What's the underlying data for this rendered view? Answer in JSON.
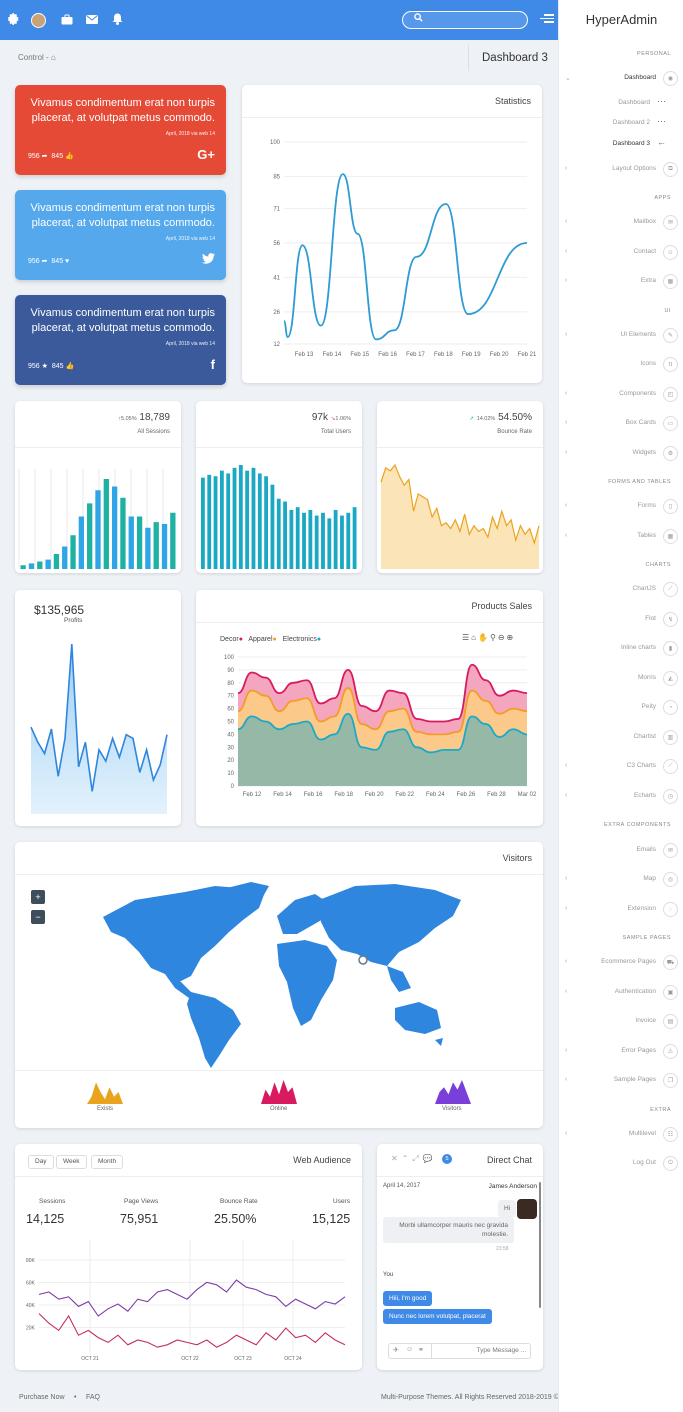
{
  "brand": {
    "bold": "Hyper",
    "rest": "Admin"
  },
  "topbar": {
    "icons": [
      "gear-icon",
      "avatar",
      "briefcase-icon",
      "mail-icon",
      "bell-icon"
    ],
    "search_placeholder": ""
  },
  "breadcrumb": {
    "text": "Control -",
    "home_icon": "home-icon"
  },
  "page_title": "Dashboard 3",
  "social_cards": [
    {
      "text": "Vivamus condimentum erat non turpis placerat, at volutpat metus commodo.",
      "meta": "April, 2018 via web 14",
      "count1": "956",
      "count2": "845",
      "brand_icon": "G+",
      "color": "#e44a36"
    },
    {
      "text": "Vivamus condimentum erat non turpis placerat, at volutpat metus commodo.",
      "meta": "April, 2018 via web 14",
      "count1": "956",
      "count2": "845",
      "brand_icon": "twitter",
      "color": "#55a8ec"
    },
    {
      "text": "Vivamus condimentum erat non turpis placerat, at volutpat metus commodo.",
      "meta": "April, 2018 via web 14",
      "count1": "956",
      "count2": "845",
      "brand_icon": "f",
      "color": "#3a5a9b"
    }
  ],
  "statistics": {
    "title": "Statistics"
  },
  "kpis": [
    {
      "change": "5.05%",
      "value": "18,789",
      "label": "All Sessions"
    },
    {
      "change": "1.06%",
      "value": "97k",
      "label": "Total Users"
    },
    {
      "change": "14.02%",
      "value": "54.50%",
      "label": "Bounce Rate"
    }
  ],
  "profits": {
    "value": "$135,965",
    "label": "Profits"
  },
  "products": {
    "title": "Products Sales",
    "legend": [
      "Decor",
      "Apparel",
      "Electronics"
    ],
    "legend_colors": [
      "#d81b60",
      "#f59b2a",
      "#1ba9c9"
    ]
  },
  "visitors": {
    "title": "Visitors",
    "zoom_in": "+",
    "zoom_out": "−",
    "spark_labels": [
      "Exists",
      "Online",
      "Visitors"
    ],
    "spark_colors": [
      "#e9a31c",
      "#d81b60",
      "#7b3fd9"
    ]
  },
  "audience": {
    "title": "Web Audience",
    "buttons": [
      "Day",
      "Week",
      "Month"
    ],
    "stats": [
      {
        "label": "Sessions",
        "value": "14,125"
      },
      {
        "label": "Page Views",
        "value": "75,951"
      },
      {
        "label": "Bounce Rate",
        "value": "25.50%"
      },
      {
        "label": "Users",
        "value": "15,125"
      }
    ],
    "xticks": [
      "OCT 21",
      "OCT 22",
      "OCT 23",
      "OCT 24"
    ],
    "yticks": [
      "80K",
      "60K",
      "40K",
      "20K"
    ]
  },
  "chat": {
    "title": "Direct Chat",
    "badge": "5",
    "date": "April 14, 2017",
    "name": "James Anderson",
    "hi": "Hi",
    "msg": "Morbi ullamcorper mauris nec gravida molestie.",
    "msg_time": "23:58",
    "you": "You",
    "r1": "Hiii, I'm good",
    "r2": "Nunc nec lorem volutpat, placerat",
    "input_placeholder": "Type Message ..."
  },
  "footer": {
    "left1": "Purchase Now",
    "left2": "FAQ",
    "right": "Multi-Purpose Themes. All Rights Reserved 2018-2019 ©"
  },
  "sidebar": {
    "sections": [
      "PERSONAL",
      "APPS",
      "UI",
      "FORMS And TABLES",
      "CHARTS",
      "EXTRA COMPONENTS",
      "SAMPLE PAGES",
      "EXTRA"
    ],
    "items": [
      "Dashboard",
      "Dashboard",
      "Dashboard 2",
      "Dashboard 3",
      "Layout Options",
      "Mailbox",
      "Contact",
      "Extra",
      "UI Elements",
      "Icons",
      "Components",
      "Box Cards",
      "Widgets",
      "Forms",
      "Tables",
      "ChartJS",
      "Flot",
      "Inline charts",
      "Morris",
      "Peity",
      "Chartist",
      "C3 Charts",
      "Echarts",
      "Emails",
      "Map",
      "Extension",
      "Ecommerce Pages",
      "Authentication",
      "Invoice",
      "Error Pages",
      "Sample Pages",
      "Multilevel",
      "Log Out"
    ]
  },
  "chart_data": [
    {
      "type": "line",
      "title": "Statistics",
      "categories": [
        "Feb 13",
        "Feb 14",
        "Feb 15",
        "Feb 16",
        "Feb 17",
        "Feb 18",
        "Feb 19",
        "Feb 20",
        "Feb 21"
      ],
      "yticks": [
        12,
        26,
        41,
        56,
        71,
        85,
        100
      ],
      "ylim": [
        12,
        100
      ],
      "values": [
        22,
        15,
        55,
        20,
        86,
        60,
        14,
        18,
        50,
        73,
        25,
        56
      ],
      "x_positions": [
        0,
        0.1,
        0.5,
        1.0,
        1.6,
        2.0,
        2.5,
        3.0,
        3.6,
        4.4,
        5.0,
        6.6
      ]
    },
    {
      "type": "bar",
      "label": "All Sessions",
      "values": [
        2,
        3,
        4,
        5,
        8,
        12,
        18,
        28,
        35,
        42,
        48,
        44,
        38,
        28,
        28,
        22,
        25,
        24,
        30
      ],
      "colors": [
        "#1fb2a2",
        "#2fa4e7"
      ]
    },
    {
      "type": "bar",
      "label": "Total Users",
      "values": [
        65,
        67,
        66,
        70,
        68,
        72,
        74,
        70,
        72,
        68,
        66,
        60,
        50,
        48,
        42,
        44,
        40,
        42,
        38,
        40,
        36,
        42,
        38,
        40,
        44
      ]
    },
    {
      "type": "area",
      "label": "Bounce Rate",
      "values": [
        60,
        70,
        68,
        72,
        64,
        58,
        62,
        40,
        52,
        50,
        48,
        36,
        42,
        30,
        32,
        28,
        34,
        26,
        38,
        24,
        30,
        26,
        28,
        22,
        36,
        28,
        40,
        30,
        34,
        20,
        30,
        24,
        28,
        18,
        30
      ]
    },
    {
      "type": "area",
      "label": "Profits",
      "values": [
        46,
        38,
        32,
        45,
        20,
        40,
        90,
        25,
        38,
        12,
        34,
        28,
        40,
        30,
        42,
        40,
        22,
        34,
        18,
        26,
        42
      ]
    },
    {
      "type": "area",
      "title": "Products Sales",
      "categories": [
        "Feb 12",
        "Feb 14",
        "Feb 16",
        "Feb 18",
        "Feb 20",
        "Feb 22",
        "Feb 24",
        "Feb 26",
        "Feb 28",
        "Mar 02"
      ],
      "ylim": [
        0,
        100
      ],
      "series": [
        {
          "name": "Decor",
          "values": [
            72,
            88,
            84,
            72,
            80,
            82,
            64,
            68,
            90,
            62,
            58,
            74,
            72,
            52,
            50,
            50,
            52,
            94,
            82,
            70,
            74,
            72
          ]
        },
        {
          "name": "Apparel",
          "values": [
            58,
            74,
            70,
            58,
            66,
            68,
            50,
            54,
            76,
            48,
            44,
            58,
            60,
            42,
            40,
            40,
            42,
            74,
            66,
            56,
            60,
            58
          ]
        },
        {
          "name": "Electronics",
          "values": [
            44,
            54,
            50,
            44,
            48,
            50,
            36,
            40,
            56,
            30,
            28,
            42,
            44,
            30,
            26,
            28,
            28,
            54,
            48,
            38,
            44,
            40
          ]
        }
      ]
    },
    {
      "type": "line",
      "title": "Web Audience",
      "series": [
        {
          "name": "s1",
          "values": [
            48,
            50,
            44,
            46,
            38,
            42,
            30,
            36,
            40,
            34,
            44,
            42,
            50,
            52,
            48,
            44,
            52,
            58,
            56,
            50,
            60,
            54,
            52,
            48,
            46,
            38,
            44,
            40,
            36,
            42,
            40,
            46
          ]
        },
        {
          "name": "s2",
          "values": [
            32,
            24,
            18,
            30,
            14,
            18,
            12,
            8,
            14,
            6,
            10,
            8,
            4,
            6,
            10,
            8,
            6,
            10,
            4,
            8,
            14,
            10,
            6,
            16,
            10,
            20,
            12,
            14,
            8,
            16,
            10,
            6
          ]
        }
      ],
      "yticks": [
        "80K",
        "60K",
        "40K",
        "20K"
      ]
    }
  ]
}
